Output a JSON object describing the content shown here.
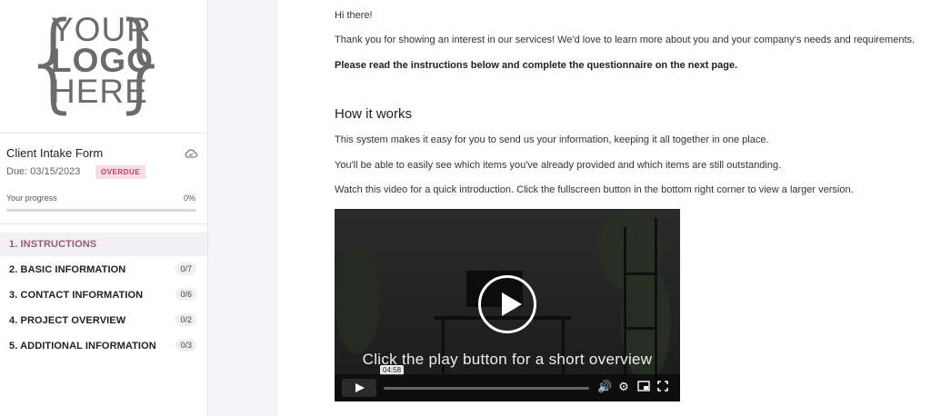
{
  "logo": {
    "line1": "YOUR",
    "line2": "LOGO",
    "line3": "HERE"
  },
  "form": {
    "title": "Client Intake Form",
    "due": "Due: 03/15/2023",
    "status_badge": "OVERDUE",
    "progress_label": "Your progress",
    "progress_percent": "0%",
    "progress_value": 0
  },
  "sections": [
    {
      "label": "1. INSTRUCTIONS",
      "count": "",
      "active": true
    },
    {
      "label": "2. BASIC INFORMATION",
      "count": "0/7",
      "active": false
    },
    {
      "label": "3. CONTACT INFORMATION",
      "count": "0/6",
      "active": false
    },
    {
      "label": "4. PROJECT OVERVIEW",
      "count": "0/2",
      "active": false
    },
    {
      "label": "5. ADDITIONAL INFORMATION",
      "count": "0/3",
      "active": false
    }
  ],
  "content": {
    "greeting": "Hi there!",
    "intro": "Thank you for showing an interest in our services! We'd love to learn more about you and your company's needs and requirements.",
    "instructions": "Please read the instructions below and complete the questionnaire on the next page.",
    "heading": "How it works",
    "para1": "This system makes it easy for you to send us your information, keeping it all together in one place.",
    "para2": "You'll be able to easily see which items you've already provided and which items are still outstanding.",
    "para3": "Watch this video for a quick introduction. Click the fullscreen button in the bottom right corner to view a larger version."
  },
  "video": {
    "caption": "Click the play button for a short overview",
    "duration": "04:58"
  },
  "icons": {
    "cloud": "cloud-sync-icon",
    "play": "play-icon",
    "volume": "volume-icon",
    "settings": "settings-icon",
    "pip": "picture-in-picture-icon",
    "fullscreen": "fullscreen-icon"
  },
  "colors": {
    "accent": "#9b5a72",
    "badge_bg": "#fadbe5",
    "badge_text": "#b0486e"
  }
}
